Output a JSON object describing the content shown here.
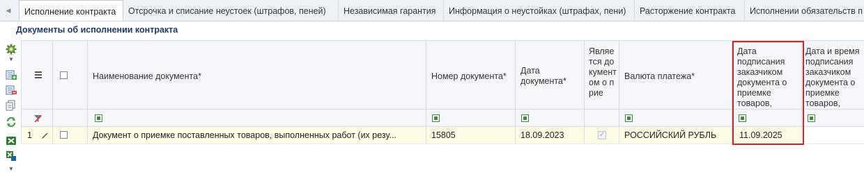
{
  "tabs": [
    {
      "label": "Исполнение контракта"
    },
    {
      "label": "Отсрочка и списание неустоек (штрафов, пеней)"
    },
    {
      "label": "Независимая гарантия"
    },
    {
      "label": "Информация о неустойках (штрафах, пени)"
    },
    {
      "label": "Расторжение контракта"
    },
    {
      "label": "Исполнении обязательств п"
    }
  ],
  "section": {
    "title": "Документы об исполнении контракта"
  },
  "grid": {
    "columns": [
      {
        "label": "Наименование документа*"
      },
      {
        "label": "Номер документа*"
      },
      {
        "label": "Дата документа*"
      },
      {
        "label": "Является документом о прие"
      },
      {
        "label": "Валюта платежа*"
      },
      {
        "label": "Дата подписания заказчиком документа о приемке товаров,"
      },
      {
        "label": "Дата и время подписания заказчиком документа о приемке товаров,"
      }
    ],
    "rows": [
      {
        "num": "1",
        "name": "Документ о приемке поставленных товаров, выполненных работ (их резу...",
        "number": "15805",
        "date": "18.09.2023",
        "is_acceptance": true,
        "currency": "РОССИЙСКИЙ РУБЛЬ",
        "sign_date": "11.09.2025",
        "sign_datetime": ""
      }
    ]
  }
}
